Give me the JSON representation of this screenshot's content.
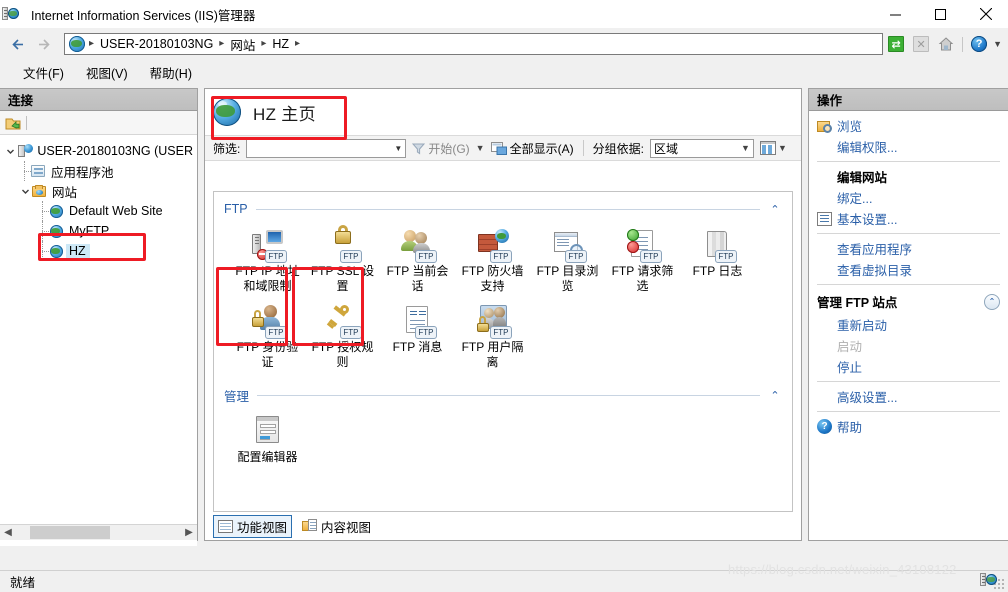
{
  "window": {
    "title": "Internet Information Services (IIS)管理器",
    "app_icon": "iis-server-icon",
    "minimize_label": "最小化",
    "maximize_label": "最大化",
    "close_label": "关闭"
  },
  "addressbar": {
    "back_label": "后退",
    "forward_label": "前进",
    "crumbs": [
      "USER-20180103NG",
      "网站",
      "HZ"
    ],
    "separator": "▸",
    "tools": [
      {
        "name": "refresh-icon",
        "glyph": "⟳",
        "enabled": true
      },
      {
        "name": "stop-icon",
        "glyph": "✕",
        "enabled": false
      },
      {
        "name": "home-icon",
        "glyph": "⌂",
        "enabled": true
      },
      {
        "name": "help-icon",
        "glyph": "?",
        "enabled": true
      }
    ]
  },
  "menubar": {
    "items": [
      {
        "label": "文件(F)",
        "accel": "F"
      },
      {
        "label": "视图(V)",
        "accel": "V"
      },
      {
        "label": "帮助(H)",
        "accel": "H"
      }
    ]
  },
  "connections": {
    "header": "连接",
    "toolbar_icon": "connect-to-server-icon",
    "tree": [
      {
        "label": "USER-20180103NG (USER",
        "icon": "server-icon",
        "depth": 0,
        "expanded": true,
        "selected": false
      },
      {
        "label": "应用程序池",
        "icon": "app-pool-icon",
        "depth": 1,
        "expanded": null,
        "selected": false
      },
      {
        "label": "网站",
        "icon": "sites-folder-icon",
        "depth": 1,
        "expanded": true,
        "selected": false
      },
      {
        "label": "Default Web Site",
        "icon": "site-icon",
        "depth": 2,
        "expanded": null,
        "selected": false
      },
      {
        "label": "MyFTP",
        "icon": "site-icon",
        "depth": 2,
        "expanded": null,
        "selected": false
      },
      {
        "label": "HZ",
        "icon": "site-icon",
        "depth": 2,
        "expanded": null,
        "selected": true
      }
    ]
  },
  "main": {
    "page_title": "HZ 主页",
    "page_icon": "site-globe-icon",
    "filter": {
      "label": "筛选:",
      "value": "",
      "placeholder": "",
      "go_label": "开始(G)",
      "go_accel": "G",
      "show_all_label": "全部显示(A)",
      "show_all_accel": "A",
      "group_by_label": "分组依据:",
      "group_by_value": "区域",
      "view_icon": "grid-view-icon"
    },
    "groups": [
      {
        "title": "FTP",
        "collapse_glyph": "⌃",
        "tiles": [
          {
            "label": "FTP IP 地址和域限制",
            "icon": "ftp-ip-address-restrictions-icon",
            "art": "ip-restrict",
            "highlighted": false
          },
          {
            "label": "FTP SSL 设置",
            "icon": "ftp-ssl-settings-icon",
            "art": "padlock",
            "highlighted": false
          },
          {
            "label": "FTP 当前会话",
            "icon": "ftp-current-sessions-icon",
            "art": "users",
            "highlighted": false
          },
          {
            "label": "FTP 防火墙支持",
            "icon": "ftp-firewall-support-icon",
            "art": "firewall",
            "highlighted": false
          },
          {
            "label": "FTP 目录浏览",
            "icon": "ftp-directory-browsing-icon",
            "art": "dirbrowse",
            "highlighted": false
          },
          {
            "label": "FTP 请求筛选",
            "icon": "ftp-request-filtering-icon",
            "art": "reqfilter",
            "highlighted": false
          },
          {
            "label": "FTP 日志",
            "icon": "ftp-logging-icon",
            "art": "books",
            "highlighted": false
          },
          {
            "label": "FTP 身份验证",
            "icon": "ftp-authentication-icon",
            "art": "authuser",
            "highlighted": true
          },
          {
            "label": "FTP 授权规则",
            "icon": "ftp-authorization-rules-icon",
            "art": "key",
            "highlighted": true
          },
          {
            "label": "FTP 消息",
            "icon": "ftp-messages-icon",
            "art": "message",
            "highlighted": false
          },
          {
            "label": "FTP 用户隔离",
            "icon": "ftp-user-isolation-icon",
            "art": "isolation",
            "highlighted": false
          }
        ]
      },
      {
        "title": "管理",
        "collapse_glyph": "⌃",
        "tiles": [
          {
            "label": "配置编辑器",
            "icon": "configuration-editor-icon",
            "art": "cfgeditor",
            "highlighted": false
          }
        ]
      }
    ],
    "view_tabs": [
      {
        "label": "功能视图",
        "icon": "features-view-icon",
        "active": true
      },
      {
        "label": "内容视图",
        "icon": "content-view-icon",
        "active": false
      }
    ]
  },
  "actions": {
    "header": "操作",
    "items": [
      {
        "label": "浏览",
        "icon": "browse-icon",
        "type": "link",
        "state": "enabled"
      },
      {
        "label": "编辑权限...",
        "icon": null,
        "type": "link",
        "state": "enabled"
      },
      {
        "type": "separator"
      },
      {
        "label": "编辑网站",
        "icon": null,
        "type": "heading",
        "state": "enabled"
      },
      {
        "label": "绑定...",
        "icon": null,
        "type": "link",
        "state": "enabled"
      },
      {
        "label": "基本设置...",
        "icon": "basic-settings-icon",
        "type": "link",
        "state": "enabled"
      },
      {
        "type": "separator"
      },
      {
        "label": "查看应用程序",
        "icon": null,
        "type": "link",
        "state": "enabled"
      },
      {
        "label": "查看虚拟目录",
        "icon": null,
        "type": "link",
        "state": "enabled"
      },
      {
        "type": "separator"
      },
      {
        "label": "管理 FTP 站点",
        "icon": null,
        "type": "group-heading",
        "state": "enabled",
        "chevron": "⌃"
      },
      {
        "label": "重新启动",
        "icon": null,
        "type": "link",
        "state": "enabled"
      },
      {
        "label": "启动",
        "icon": null,
        "type": "link",
        "state": "disabled"
      },
      {
        "label": "停止",
        "icon": null,
        "type": "link",
        "state": "enabled"
      },
      {
        "type": "separator"
      },
      {
        "label": "高级设置...",
        "icon": null,
        "type": "link",
        "state": "enabled"
      },
      {
        "type": "separator"
      },
      {
        "label": "帮助",
        "icon": "help-circle-icon",
        "type": "link",
        "state": "enabled"
      }
    ]
  },
  "statusbar": {
    "text": "就绪"
  },
  "watermark": {
    "text": "https://blog.csdn.net/weixin_43108122"
  },
  "colors": {
    "accent_link": "#2a5fa8",
    "group_title": "#2a5fa8",
    "highlight_box": "#ee1b24",
    "selection": "#cde8f6",
    "panel_header": "#c4c4c4"
  }
}
